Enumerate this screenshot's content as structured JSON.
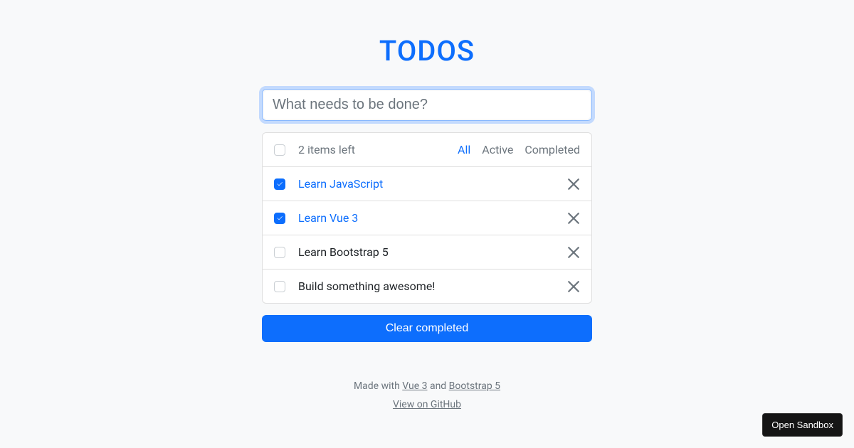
{
  "title": "TODOS",
  "input": {
    "placeholder": "What needs to be done?",
    "value": ""
  },
  "header": {
    "items_left": "2 items left",
    "filters": {
      "all": "All",
      "active": "Active",
      "completed": "Completed",
      "selected": "all"
    }
  },
  "todos": [
    {
      "label": "Learn JavaScript",
      "done": true
    },
    {
      "label": "Learn Vue 3",
      "done": true
    },
    {
      "label": "Learn Bootstrap 5",
      "done": false
    },
    {
      "label": "Build something awesome!",
      "done": false
    }
  ],
  "clear_label": "Clear completed",
  "footer": {
    "prefix": "Made with ",
    "link1": "Vue 3",
    "mid": " and ",
    "link2": "Bootstrap 5",
    "github": "View on GitHub"
  },
  "sandbox_label": "Open Sandbox"
}
